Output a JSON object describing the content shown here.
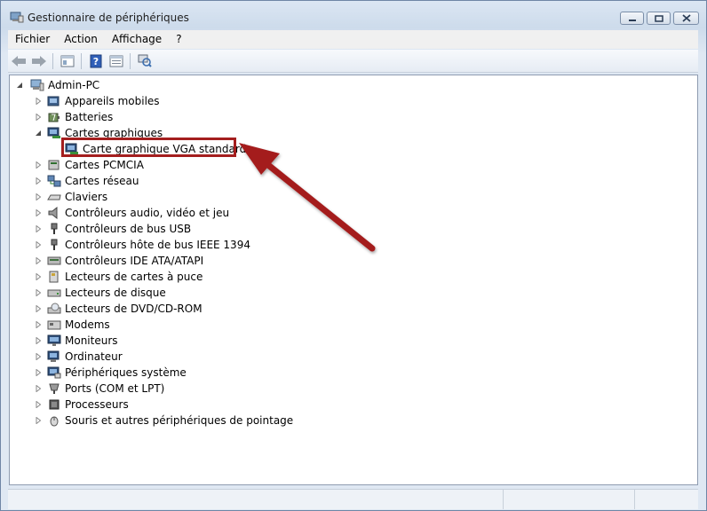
{
  "window": {
    "title": "Gestionnaire de périphériques"
  },
  "menu": {
    "items": [
      "Fichier",
      "Action",
      "Affichage",
      "?"
    ]
  },
  "tree": {
    "root": "Admin-PC",
    "categories": [
      {
        "label": "Appareils mobiles",
        "icon": "mobile-device-icon"
      },
      {
        "label": "Batteries",
        "icon": "battery-icon"
      },
      {
        "label": "Cartes graphiques",
        "icon": "display-adapter-icon",
        "expanded": true,
        "children": [
          "Carte graphique VGA standard"
        ]
      },
      {
        "label": "Cartes PCMCIA",
        "icon": "pcmcia-icon"
      },
      {
        "label": "Cartes réseau",
        "icon": "network-adapter-icon"
      },
      {
        "label": "Claviers",
        "icon": "keyboard-icon"
      },
      {
        "label": "Contrôleurs audio, vidéo et jeu",
        "icon": "speaker-icon"
      },
      {
        "label": "Contrôleurs de bus USB",
        "icon": "usb-icon"
      },
      {
        "label": "Contrôleurs hôte de bus IEEE 1394",
        "icon": "firewire-icon"
      },
      {
        "label": "Contrôleurs IDE ATA/ATAPI",
        "icon": "ide-controller-icon"
      },
      {
        "label": "Lecteurs de cartes à puce",
        "icon": "smartcard-reader-icon"
      },
      {
        "label": "Lecteurs de disque",
        "icon": "disk-drive-icon"
      },
      {
        "label": "Lecteurs de DVD/CD-ROM",
        "icon": "dvd-drive-icon"
      },
      {
        "label": "Modems",
        "icon": "modem-icon"
      },
      {
        "label": "Moniteurs",
        "icon": "monitor-icon"
      },
      {
        "label": "Ordinateur",
        "icon": "computer-icon"
      },
      {
        "label": "Périphériques système",
        "icon": "system-device-icon"
      },
      {
        "label": "Ports (COM et LPT)",
        "icon": "port-icon"
      },
      {
        "label": "Processeurs",
        "icon": "processor-icon"
      },
      {
        "label": "Souris et autres périphériques de pointage",
        "icon": "mouse-icon"
      }
    ]
  },
  "annotation": {
    "highlight_color": "#a41e1e"
  }
}
